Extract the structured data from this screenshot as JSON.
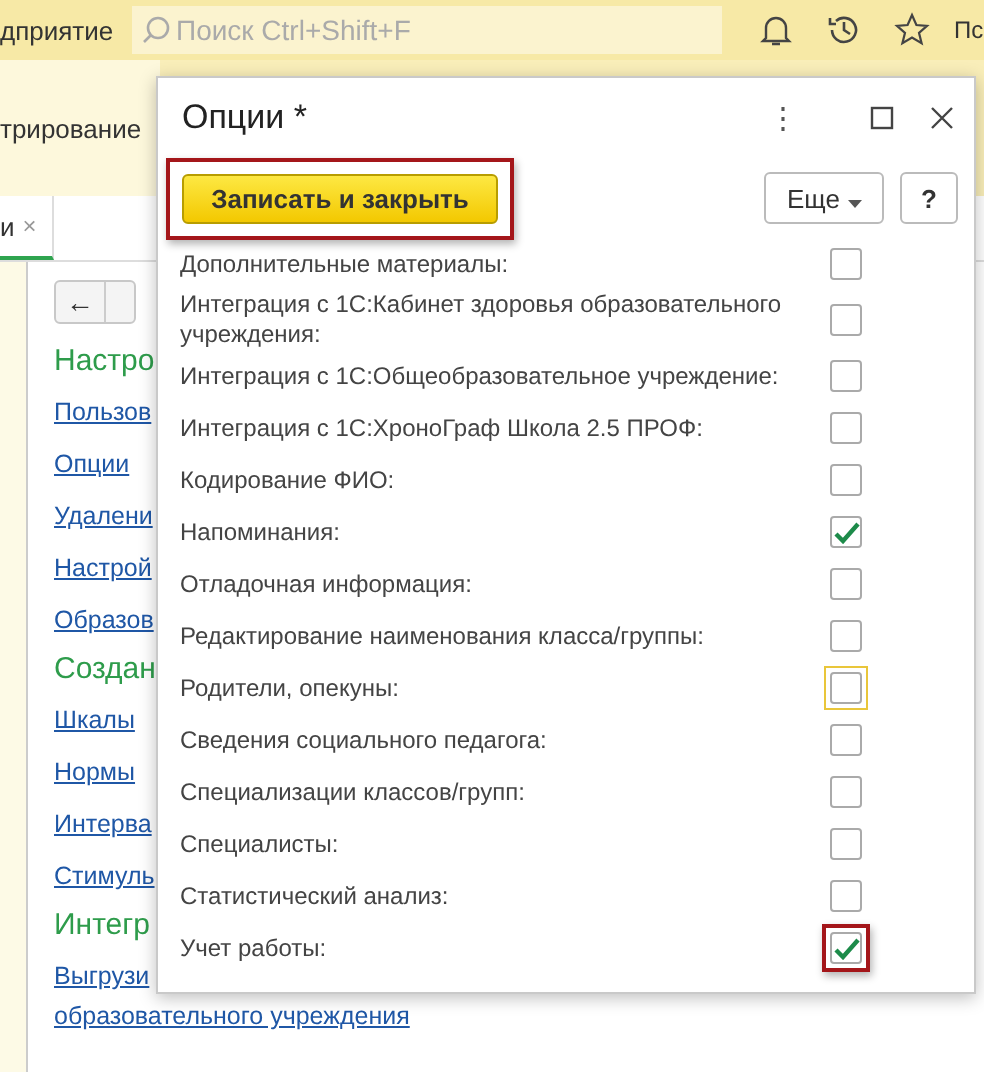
{
  "top_bar": {
    "app_title": "дприятие",
    "search": {
      "placeholder": "Поиск Ctrl+Shift+F"
    },
    "user": "Пс"
  },
  "sub_bar": {
    "label": "трирование"
  },
  "tab": {
    "label": "и",
    "close": "×"
  },
  "nav": {
    "back": "←"
  },
  "sections": [
    {
      "heading": "Настро",
      "links": [
        "Пользов",
        "Опции",
        "Удалени",
        "Настрой",
        "Образов"
      ]
    },
    {
      "heading": "Создан",
      "links": [
        "Шкалы",
        "Нормы",
        "Интерва",
        "Стимуль"
      ]
    },
    {
      "heading": "Интегр",
      "links": [
        "Выгрузи",
        "образовательного учреждения"
      ]
    }
  ],
  "dialog": {
    "title": "Опции *",
    "menu": "⋮",
    "save_button": {
      "label": "Записать и закрыть",
      "highlighted": true
    },
    "more_button": "Еще",
    "help_button": "?",
    "options": [
      {
        "label": "Дополнительные материалы:",
        "checked": false,
        "focused": false,
        "highlighted": false
      },
      {
        "label": "Интеграция с 1С:Кабинет здоровья образовательного учреждения:",
        "checked": false,
        "focused": false,
        "highlighted": false
      },
      {
        "label": "Интеграция с 1С:Общеобразовательное учреждение:",
        "checked": false,
        "focused": false,
        "highlighted": false
      },
      {
        "label": "Интеграция с 1С:ХроноГраф Школа 2.5 ПРОФ:",
        "checked": false,
        "focused": false,
        "highlighted": false
      },
      {
        "label": "Кодирование ФИО:",
        "checked": false,
        "focused": false,
        "highlighted": false
      },
      {
        "label": "Напоминания:",
        "checked": true,
        "focused": false,
        "highlighted": false
      },
      {
        "label": "Отладочная информация:",
        "checked": false,
        "focused": false,
        "highlighted": false
      },
      {
        "label": "Редактирование наименования класса/группы:",
        "checked": false,
        "focused": false,
        "highlighted": false
      },
      {
        "label": "Родители, опекуны:",
        "checked": false,
        "focused": true,
        "highlighted": false
      },
      {
        "label": "Сведения социального педагога:",
        "checked": false,
        "focused": false,
        "highlighted": false
      },
      {
        "label": "Специализации классов/групп:",
        "checked": false,
        "focused": false,
        "highlighted": false
      },
      {
        "label": "Специалисты:",
        "checked": false,
        "focused": false,
        "highlighted": false
      },
      {
        "label": "Статистический анализ:",
        "checked": false,
        "focused": false,
        "highlighted": false
      },
      {
        "label": "Учет работы:",
        "checked": true,
        "focused": false,
        "highlighted": true
      }
    ]
  }
}
